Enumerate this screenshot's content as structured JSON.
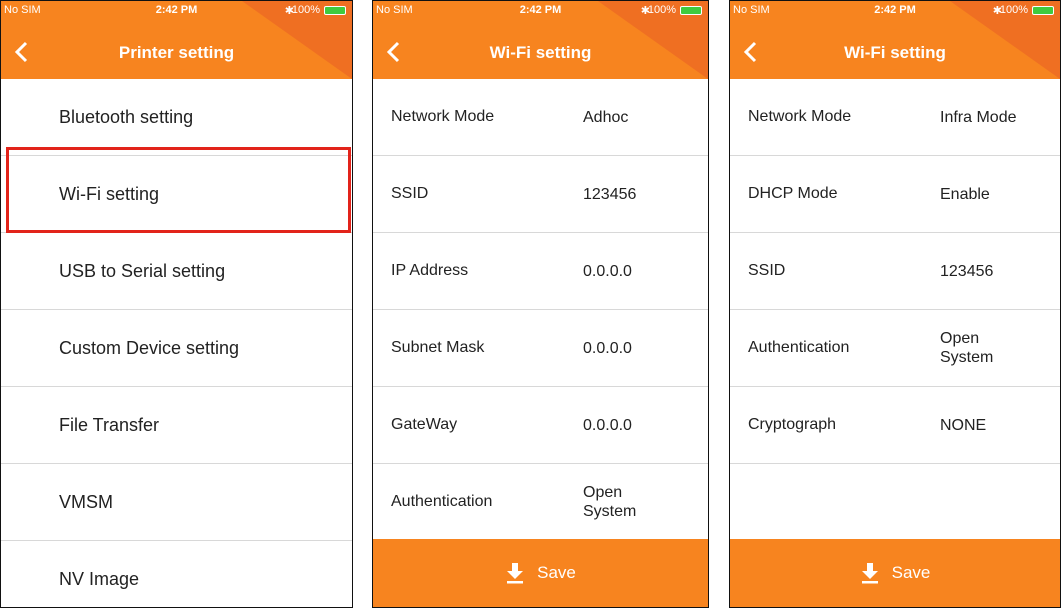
{
  "status": {
    "sim": "No SIM",
    "time": "2:42 PM",
    "battery": "100%"
  },
  "screen1": {
    "title": "Printer setting",
    "items": [
      "Bluetooth setting",
      "Wi-Fi setting",
      "USB to Serial setting",
      "Custom Device setting",
      "File Transfer",
      "VMSM",
      "NV Image"
    ]
  },
  "screen2": {
    "title": "Wi-Fi setting",
    "rows": [
      {
        "label": "Network Mode",
        "value": "Adhoc"
      },
      {
        "label": "SSID",
        "value": "123456"
      },
      {
        "label": "IP Address",
        "value": "0.0.0.0"
      },
      {
        "label": "Subnet Mask",
        "value": "0.0.0.0"
      },
      {
        "label": "GateWay",
        "value": "0.0.0.0"
      },
      {
        "label": "Authentication",
        "value_line1": "Open",
        "value_line2": "System"
      }
    ],
    "save_label": "Save"
  },
  "screen3": {
    "title": "Wi-Fi setting",
    "rows": [
      {
        "label": "Network Mode",
        "value": "Infra Mode"
      },
      {
        "label": "DHCP Mode",
        "value": "Enable"
      },
      {
        "label": "SSID",
        "value": "123456"
      },
      {
        "label": "Authentication",
        "value_line1": "Open",
        "value_line2": "System"
      },
      {
        "label": "Cryptograph",
        "value": "NONE"
      }
    ],
    "save_label": "Save"
  },
  "colors": {
    "header": "#f7841f",
    "header_accent": "#ef6f22",
    "highlight": "#e2231a",
    "battery": "#3fcb3f"
  }
}
